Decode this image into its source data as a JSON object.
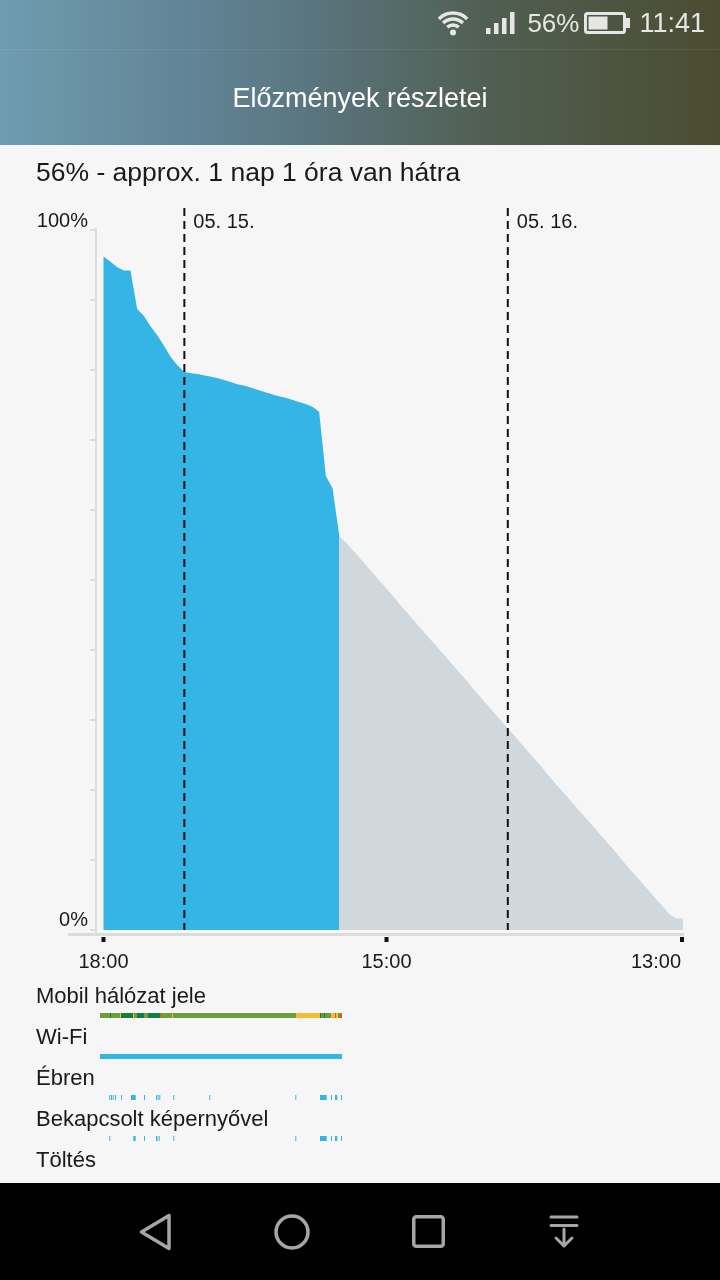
{
  "status_bar": {
    "battery_percent": "56%",
    "time": "11:41"
  },
  "header": {
    "title": "Előzmények részletei"
  },
  "summary": "56% - approx. 1 nap 1 óra van hátra",
  "battery_chart": {
    "chart_data": {
      "type": "area",
      "categories": [
        "18:00",
        null,
        null,
        null,
        null,
        null,
        null,
        null,
        null,
        null,
        null,
        null,
        null,
        null,
        null,
        null,
        null,
        null,
        null,
        null,
        null,
        null,
        null,
        null,
        null,
        null,
        null,
        null,
        null,
        null,
        null,
        null,
        null,
        null,
        null,
        null,
        null,
        null,
        null,
        null,
        null,
        null,
        "15:00",
        null,
        null,
        null,
        null,
        null,
        null,
        null,
        null,
        null,
        null,
        null,
        null,
        null,
        null,
        null,
        null,
        null,
        null,
        null,
        null,
        null,
        null,
        null,
        null,
        null,
        null,
        null,
        null,
        null,
        null,
        null,
        null,
        null,
        null,
        null,
        null,
        null,
        null,
        null,
        "13:00",
        null,
        null,
        null,
        null
      ],
      "series": [
        {
          "color": "#35b5e5",
          "values": [
            94.7,
            94,
            93.2,
            92.7,
            92.7,
            87.2,
            86.2,
            84.7,
            83.4,
            81.9,
            80.3,
            79.1,
            78.2,
            78,
            77.9,
            77.7,
            77.5,
            77.3,
            77,
            76.7,
            76.4,
            76.2,
            75.9,
            75.6,
            75.3,
            75,
            74.7,
            74.5,
            74.2,
            73.9,
            73.6,
            73.2,
            72.5,
            63.3,
            61.5,
            54.7,
            null,
            null,
            null,
            null,
            null,
            null,
            null,
            null,
            null,
            null,
            null,
            null,
            null,
            null,
            null,
            null,
            null,
            null,
            null,
            null,
            null,
            null,
            null,
            null,
            null,
            null,
            null,
            null,
            null,
            null,
            null,
            null,
            null,
            null,
            null,
            null,
            null,
            null,
            null,
            null,
            null,
            null,
            null,
            null,
            null,
            null,
            null,
            null,
            null,
            null,
            null
          ]
        },
        {
          "color": "#d0d8de",
          "values": [
            null,
            null,
            null,
            null,
            null,
            null,
            null,
            null,
            null,
            null,
            null,
            null,
            null,
            null,
            null,
            null,
            null,
            null,
            null,
            null,
            null,
            null,
            null,
            null,
            null,
            null,
            null,
            null,
            null,
            null,
            null,
            null,
            null,
            null,
            null,
            54.7,
            53.8,
            52.7,
            51.6,
            50.5,
            49.4,
            48.3,
            47.2,
            46.1,
            44.9,
            43.8,
            42.7,
            41.6,
            40.5,
            39.4,
            38.3,
            37.2,
            36.1,
            35,
            33.9,
            32.7,
            31.6,
            30.5,
            29.4,
            28.3,
            27.2,
            26.1,
            25,
            23.9,
            22.8,
            21.7,
            20.5,
            19.4,
            18.3,
            17.2,
            16.1,
            15,
            13.9,
            12.8,
            11.7,
            10.6,
            9.5,
            8.3,
            7.2,
            6.1,
            5,
            3.9,
            2.8,
            1.7,
            0.6,
            0,
            0
          ]
        }
      ],
      "ylim": [
        0,
        100
      ],
      "yticks": [
        {
          "value": 0,
          "label": "0%"
        },
        {
          "value": 100,
          "label": "100%"
        }
      ],
      "annotations": [
        "05. 15.",
        "05. 16."
      ]
    }
  },
  "timelines": [
    {
      "label": "Mobil hálózat jele",
      "kind": "signal"
    },
    {
      "label": "Wi-Fi",
      "kind": "wifi"
    },
    {
      "label": "Ébren",
      "kind": "awake"
    },
    {
      "label": "Bekapcsolt képernyővel",
      "kind": "screen"
    },
    {
      "label": "Töltés",
      "kind": "charging"
    }
  ]
}
